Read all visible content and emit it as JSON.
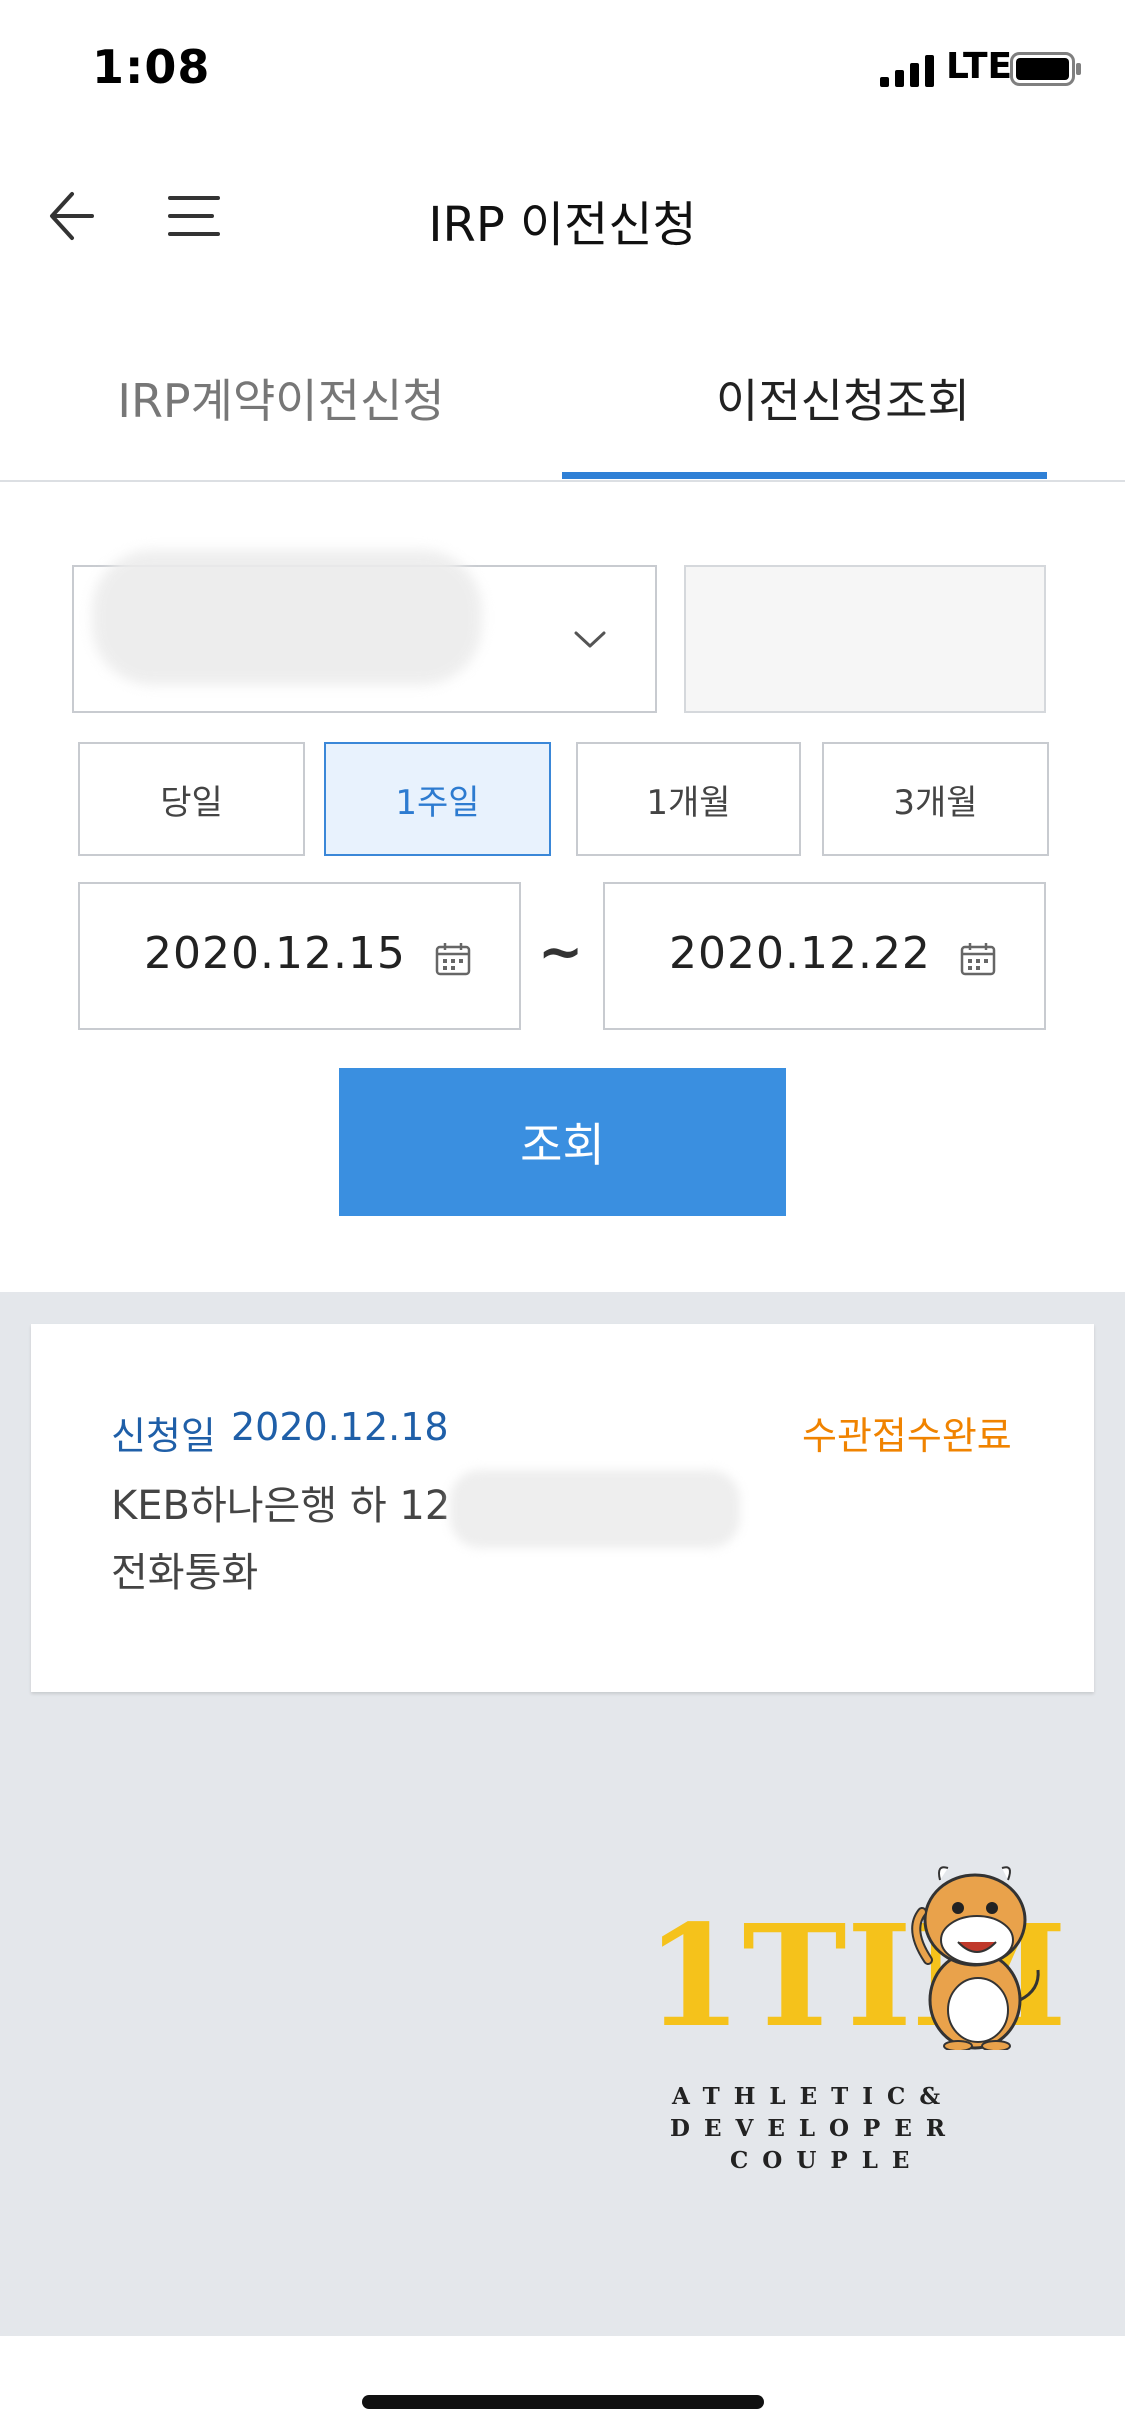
{
  "status_bar": {
    "time": "1:08",
    "network": "LTE"
  },
  "header": {
    "title": "IRP 이전신청",
    "back_icon": "arrow-left-icon",
    "menu_icon": "hamburger-menu-icon"
  },
  "tabs": [
    {
      "label": "IRP계약이전신청",
      "active": false
    },
    {
      "label": "이전신청조회",
      "active": true
    }
  ],
  "filter": {
    "account_select_icon": "chevron-down-icon",
    "periods": [
      {
        "label": "당일",
        "selected": false
      },
      {
        "label": "1주일",
        "selected": true
      },
      {
        "label": "1개월",
        "selected": false
      },
      {
        "label": "3개월",
        "selected": false
      }
    ],
    "date_from": "2020.12.15",
    "date_to": "2020.12.22",
    "date_separator": "~",
    "calendar_icon": "calendar-icon",
    "search_label": "조회"
  },
  "results": [
    {
      "date_label": "신청일",
      "date": "2020.12.18",
      "status": "수관접수완료",
      "bank_line": "KEB하나은행 하  12",
      "currency_line": "전화통화"
    }
  ],
  "logo": {
    "text": "1TIM",
    "tagline": [
      "ATHLETIC&",
      "DEVELOPER",
      "COUPLE"
    ]
  },
  "colors": {
    "accent": "#2f80d6",
    "button": "#3a8fe0",
    "status_orange": "#f08300",
    "date_blue": "#1f5fa8",
    "logo_yellow": "#f5c21b"
  }
}
